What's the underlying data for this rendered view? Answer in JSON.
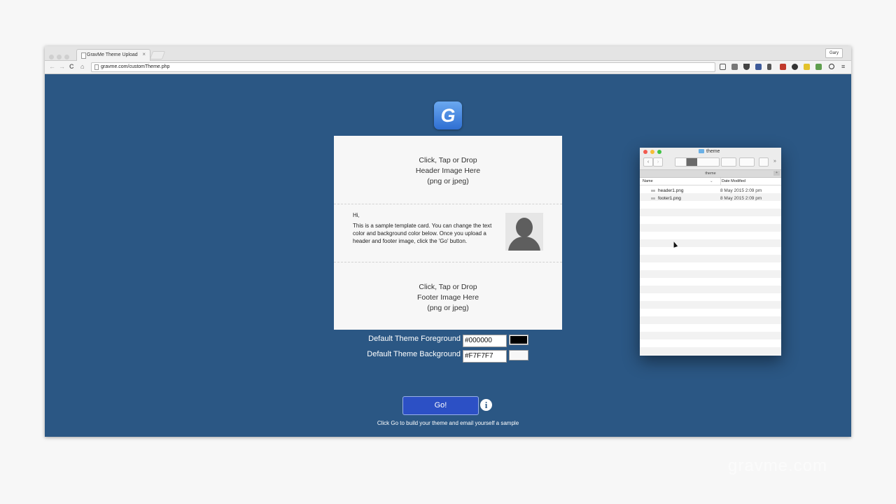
{
  "browser": {
    "tab_title": "GravMe Theme Upload",
    "tab_close": "×",
    "url": "gravme.com/customTheme.php",
    "user_button": "Gary",
    "nav": {
      "back": "←",
      "forward": "→",
      "reload": "C",
      "home": "⌂",
      "menu": "≡"
    }
  },
  "page": {
    "logo_letter": "G",
    "header_drop": {
      "line1": "Click, Tap or Drop",
      "line2": "Header Image Here",
      "line3": "(png or jpeg)"
    },
    "template": {
      "greeting": "Hi,",
      "message": "This is a sample template card. You can change the text color and background color below. Once you upload a header and footer image, click the 'Go' button."
    },
    "footer_drop": {
      "line1": "Click, Tap or Drop",
      "line2": "Footer Image Here",
      "line3": "(png or jpeg)"
    },
    "foreground": {
      "label": "Default Theme Foreground",
      "value": "#000000",
      "swatch_color": "#000000"
    },
    "background": {
      "label": "Default Theme Background",
      "value": "#F7F7F7",
      "swatch_color": "#F7F7F7"
    },
    "go_label": "Go!",
    "info_glyph": "i",
    "hint": "Click Go to build your theme and email yourself a sample"
  },
  "finder": {
    "title": "theme",
    "path": "theme",
    "columns": {
      "name": "Name",
      "date": "Date Modified",
      "sort_glyph": "⌄"
    },
    "files": [
      {
        "name": "header1.png",
        "date": "8 May 2015 2:09 pm"
      },
      {
        "name": "footer1.png",
        "date": "8 May 2015 2:09 pm"
      }
    ],
    "toolbar": {
      "back": "‹",
      "forward": "›",
      "more": "»",
      "add": "+"
    }
  },
  "watermark": "gravme.com"
}
